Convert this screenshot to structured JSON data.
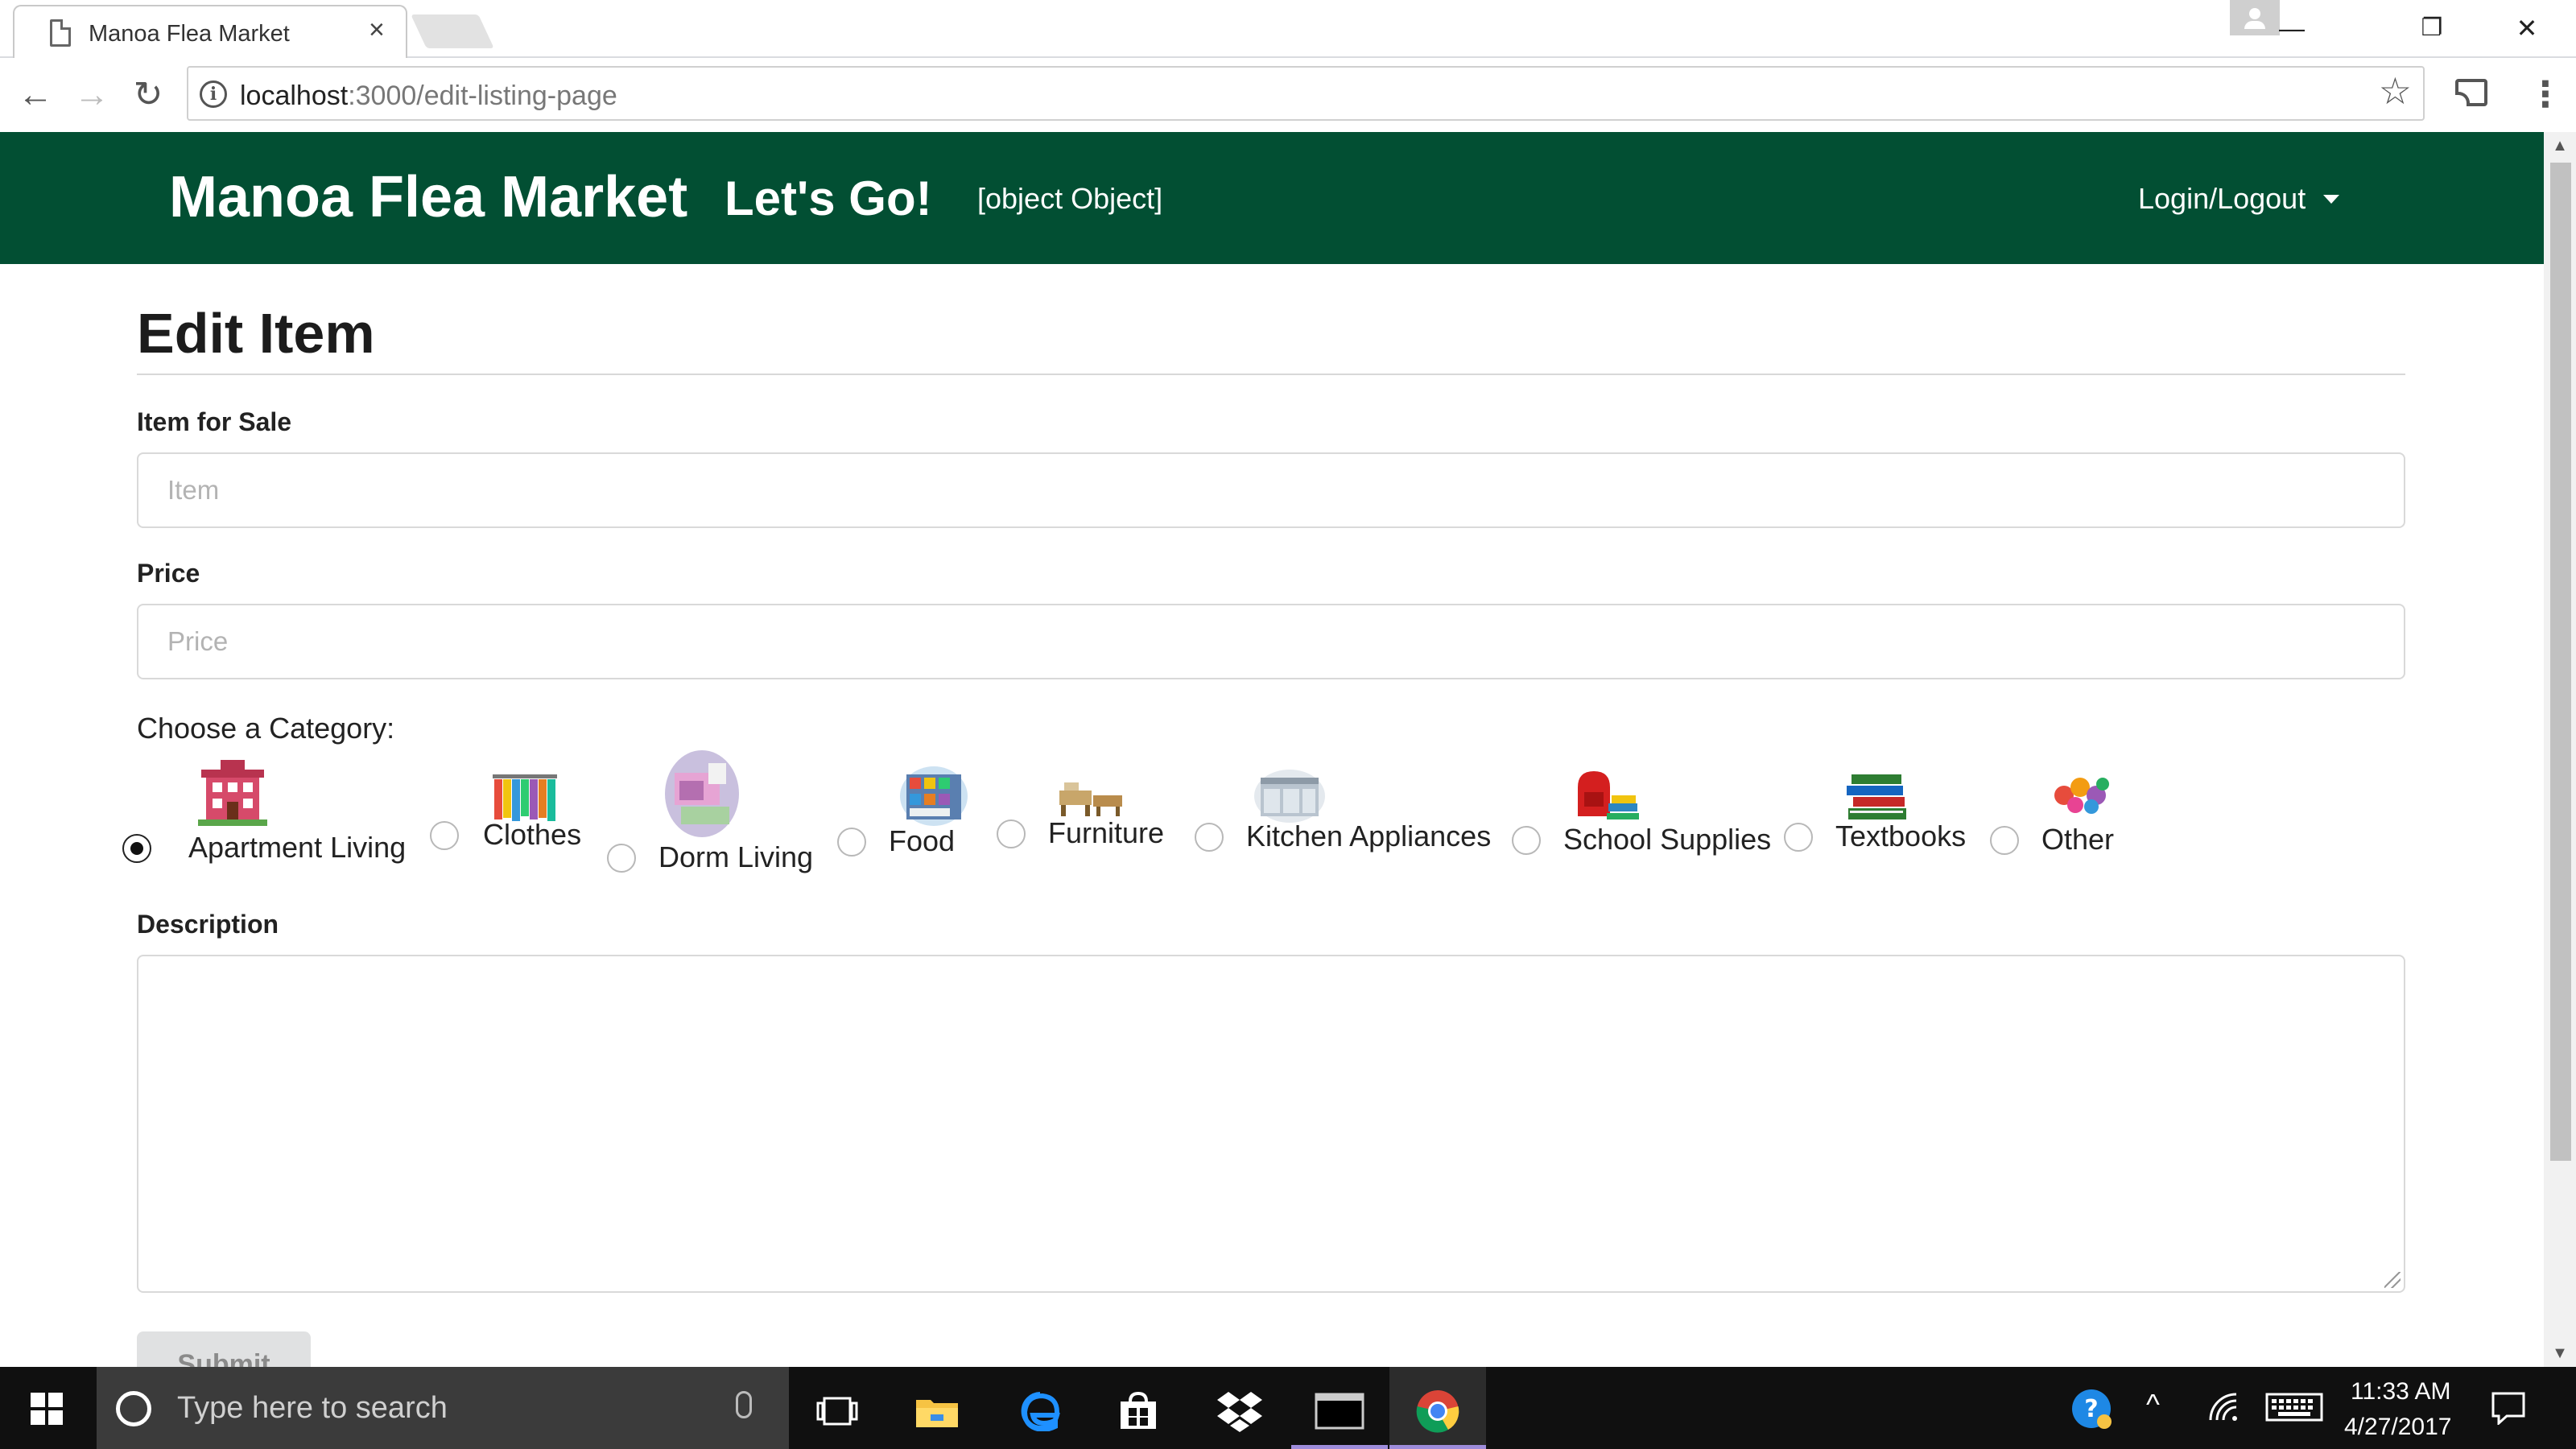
{
  "browser": {
    "tab_title": "Manoa Flea Market",
    "tab_close": "×",
    "url_host": "localhost",
    "url_rest": ":3000/edit-listing-page",
    "window_buttons": {
      "minimize": "—",
      "restore": "❐",
      "close": "✕"
    },
    "nav": {
      "back": "←",
      "forward": "→",
      "reload": "↻"
    },
    "info": "i",
    "star": "☆",
    "menu": "⋮"
  },
  "navbar": {
    "brand": "Manoa Flea Market",
    "lets_go": "Let's Go!",
    "object_text": "[object Object]",
    "login": "Login/Logout",
    "bg_color": "#024f33"
  },
  "form": {
    "title": "Edit Item",
    "item_label": "Item for Sale",
    "item_placeholder": "Item",
    "item_value": "",
    "price_label": "Price",
    "price_placeholder": "Price",
    "price_value": "",
    "category_label": "Choose a Category:",
    "categories": [
      {
        "label": "Apartment Living",
        "selected": true,
        "icon": "apartment-building-icon"
      },
      {
        "label": "Clothes",
        "selected": false,
        "icon": "clothes-rack-icon"
      },
      {
        "label": "Dorm Living",
        "selected": false,
        "icon": "dorm-room-icon"
      },
      {
        "label": "Food",
        "selected": false,
        "icon": "grocery-shelf-icon"
      },
      {
        "label": "Furniture",
        "selected": false,
        "icon": "furniture-icon"
      },
      {
        "label": "Kitchen Appliances",
        "selected": false,
        "icon": "kitchen-icon"
      },
      {
        "label": "School Supplies",
        "selected": false,
        "icon": "school-backpack-icon"
      },
      {
        "label": "Textbooks",
        "selected": false,
        "icon": "book-stack-icon"
      },
      {
        "label": "Other",
        "selected": false,
        "icon": "assorted-items-icon"
      }
    ],
    "description_label": "Description",
    "description_value": "",
    "submit_label": "Submit"
  },
  "taskbar": {
    "search_placeholder": "Type here to search",
    "time": "11:33 AM",
    "date": "4/27/2017",
    "tray_help": "?",
    "tray_chevron": "^"
  }
}
